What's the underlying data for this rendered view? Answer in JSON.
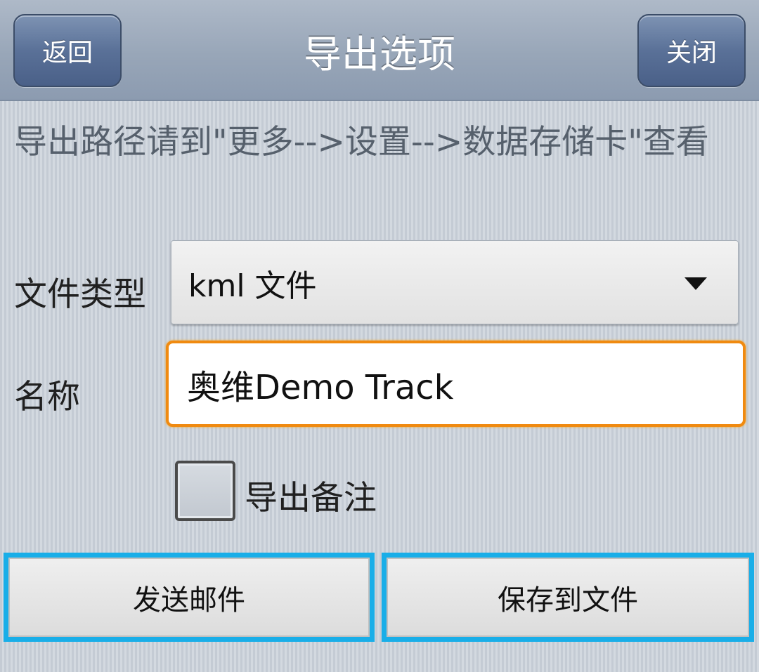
{
  "header": {
    "title": "导出选项",
    "back_label": "返回",
    "close_label": "关闭"
  },
  "hint": "导出路径请到\"更多-->设置-->数据存储卡\"查看",
  "form": {
    "file_type": {
      "label": "文件类型",
      "selected": "kml 文件",
      "icon": "dropdown-arrow-icon"
    },
    "name": {
      "label": "名称",
      "value": "奥维Demo Track"
    },
    "export_notes": {
      "label": "导出备注",
      "checked": false
    }
  },
  "actions": {
    "send_email_label": "发送邮件",
    "save_to_file_label": "保存到文件"
  },
  "colors": {
    "nav_button": "#5a7198",
    "input_focus_border": "#f08a10",
    "action_button_border": "#19aee8"
  }
}
